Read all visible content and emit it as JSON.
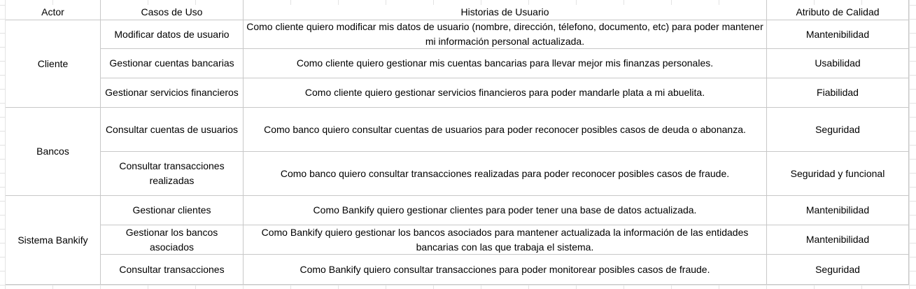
{
  "headers": {
    "actor": "Actor",
    "casos": "Casos de Uso",
    "historias": "Historias de Usuario",
    "atributo": "Atributo de Calidad"
  },
  "actors": [
    "Cliente",
    "Bancos",
    "Sistema Bankify"
  ],
  "rows": [
    {
      "caso": "Modificar datos de usuario",
      "historia": "Como cliente quiero modificar mis datos de usuario (nombre, dirección, télefono, documento, etc) para poder mantener mi información personal actualizada.",
      "atributo": "Mantenibilidad"
    },
    {
      "caso": "Gestionar cuentas bancarias",
      "historia": "Como cliente quiero gestionar mis cuentas bancarias para llevar mejor mis finanzas personales.",
      "atributo": "Usabilidad"
    },
    {
      "caso": "Gestionar servicios financieros",
      "historia": "Como cliente quiero gestionar servicios financieros para poder mandarle plata a mi abuelita.",
      "atributo": "Fiabilidad"
    },
    {
      "caso": "Consultar cuentas de usuarios",
      "historia": "Como banco quiero consultar cuentas de usuarios para poder reconocer posibles casos de deuda o abonanza.",
      "atributo": "Seguridad"
    },
    {
      "caso": "Consultar  transacciones realizadas",
      "historia": "Como banco quiero consultar transacciones realizadas para poder reconocer posibles casos de fraude.",
      "atributo": "Seguridad y funcional"
    },
    {
      "caso": "Gestionar clientes",
      "historia": "Como Bankify quiero gestionar clientes para poder tener una base de datos actualizada.",
      "atributo": "Mantenibilidad"
    },
    {
      "caso": "Gestionar los bancos asociados",
      "historia": "Como Bankify quiero gestionar los bancos asociados para mantener actualizada la información de las entidades bancarias con las que trabaja el sistema.",
      "atributo": "Mantenibilidad"
    },
    {
      "caso": "Consultar transacciones",
      "historia": "Como Bankify quiero consultar transacciones para poder monitorear posibles casos de fraude.",
      "atributo": "Seguridad"
    }
  ]
}
